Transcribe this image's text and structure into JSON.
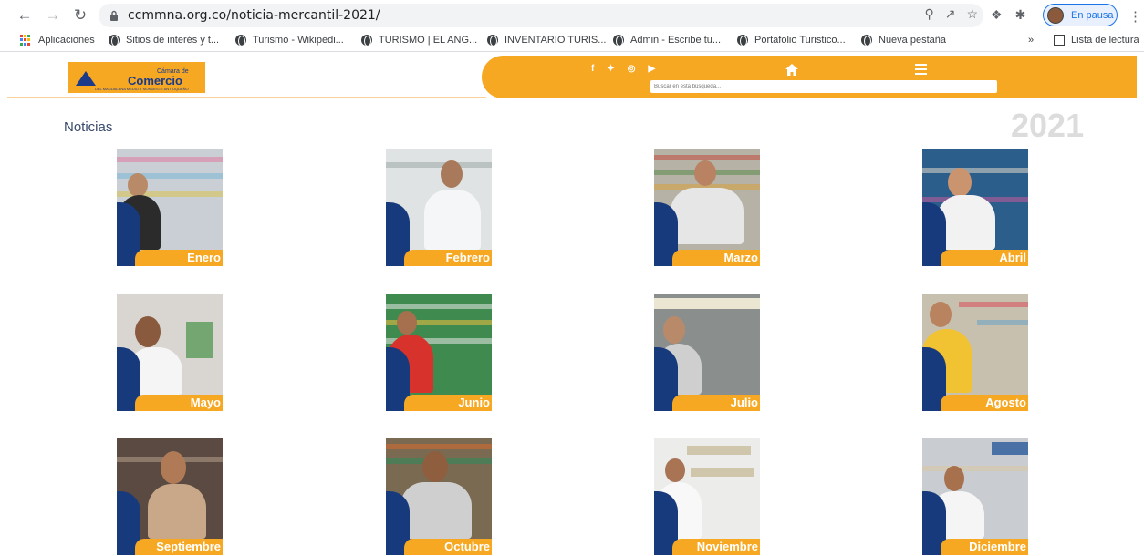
{
  "browser": {
    "url": "ccmmna.org.co/noticia-mercantil-2021/",
    "profile_label": "En pausa",
    "reading_list_label": "Lista de lectura",
    "bookmarks_more": "»",
    "bookmarks": [
      {
        "label": "Aplicaciones",
        "icon": "apps-grid-icon"
      },
      {
        "label": "Sitios de interés y t...",
        "icon": "globe-icon"
      },
      {
        "label": "Turismo - Wikipedi...",
        "icon": "globe-icon"
      },
      {
        "label": "TURISMO | EL ANG...",
        "icon": "globe-icon"
      },
      {
        "label": "INVENTARIO TURIS...",
        "icon": "globe-icon"
      },
      {
        "label": "Admin - Escribe tu...",
        "icon": "globe-icon"
      },
      {
        "label": "Portafolio Turistico...",
        "icon": "globe-icon"
      },
      {
        "label": "Nueva pestaña",
        "icon": "globe-icon"
      }
    ]
  },
  "site": {
    "logo_line1": "Cámara de",
    "logo_line2": "Comercio",
    "logo_tagline": "DEL MAGDALENA MEDIO Y NORDESTE ANTIOQUEÑO",
    "social": [
      "f",
      "t",
      "ig",
      "yt"
    ],
    "search_placeholder": "Buscar en esta búsqueda...",
    "colors": {
      "orange": "#f7a823",
      "blue": "#173a7d"
    }
  },
  "content": {
    "title": "Noticias",
    "year": "2021",
    "months": [
      {
        "label": "Enero"
      },
      {
        "label": "Febrero"
      },
      {
        "label": "Marzo"
      },
      {
        "label": "Abril"
      },
      {
        "label": "Mayo"
      },
      {
        "label": "Junio"
      },
      {
        "label": "Julio"
      },
      {
        "label": "Agosto"
      },
      {
        "label": "Septiembre"
      },
      {
        "label": "Octubre"
      },
      {
        "label": "Noviembre"
      },
      {
        "label": "Diciembre"
      }
    ]
  }
}
